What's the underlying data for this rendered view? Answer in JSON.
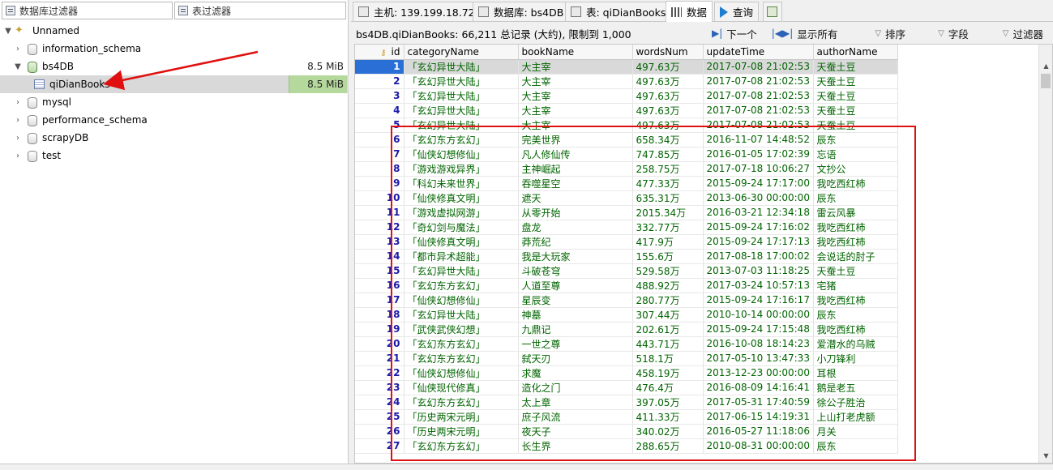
{
  "filters": {
    "db_filter_placeholder": "数据库过滤器",
    "table_filter_placeholder": "表过滤器"
  },
  "tree": {
    "root": "Unnamed",
    "databases": [
      {
        "name": "information_schema",
        "size": ""
      },
      {
        "name": "bs4DB",
        "size": "8.5 MiB"
      },
      {
        "name": "mysql",
        "size": ""
      },
      {
        "name": "performance_schema",
        "size": ""
      },
      {
        "name": "scrapyDB",
        "size": ""
      },
      {
        "name": "test",
        "size": ""
      }
    ],
    "selected_table": {
      "name": "qiDianBooks",
      "size": "8.5 MiB"
    }
  },
  "tabs": [
    {
      "label": "主机: 139.199.18.72"
    },
    {
      "label": "数据库: bs4DB"
    },
    {
      "label": "表: qiDianBooks"
    },
    {
      "label": "数据"
    },
    {
      "label": "查询"
    }
  ],
  "info_bar": {
    "text": "bs4DB.qiDianBooks: 66,211 总记录 (大约), 限制到 1,000",
    "next_label": "下一个",
    "show_all_label": "显示所有",
    "sort_label": "排序",
    "fields_label": "字段",
    "filter_label": "过滤器"
  },
  "table": {
    "columns": [
      "id",
      "categoryName",
      "bookName",
      "wordsNum",
      "updateTime",
      "authorName"
    ],
    "rows": [
      [
        "1",
        "「玄幻异世大陆」",
        "大主宰",
        "497.63万",
        "2017-07-08 21:02:53",
        "天蚕土豆"
      ],
      [
        "2",
        "「玄幻异世大陆」",
        "大主宰",
        "497.63万",
        "2017-07-08 21:02:53",
        "天蚕土豆"
      ],
      [
        "3",
        "「玄幻异世大陆」",
        "大主宰",
        "497.63万",
        "2017-07-08 21:02:53",
        "天蚕土豆"
      ],
      [
        "4",
        "「玄幻异世大陆」",
        "大主宰",
        "497.63万",
        "2017-07-08 21:02:53",
        "天蚕土豆"
      ],
      [
        "5",
        "「玄幻异世大陆」",
        "大主宰",
        "497.63万",
        "2017-07-08 21:02:53",
        "天蚕土豆"
      ],
      [
        "6",
        "「玄幻东方玄幻」",
        "完美世界",
        "658.34万",
        "2016-11-07 14:48:52",
        "辰东"
      ],
      [
        "7",
        "「仙侠幻想修仙」",
        "凡人修仙传",
        "747.85万",
        "2016-01-05 17:02:39",
        "忘语"
      ],
      [
        "8",
        "「游戏游戏异界」",
        "主神崛起",
        "258.75万",
        "2017-07-18 10:06:27",
        "文抄公"
      ],
      [
        "9",
        "「科幻未来世界」",
        "吞噬星空",
        "477.33万",
        "2015-09-24 17:17:00",
        "我吃西红柿"
      ],
      [
        "10",
        "「仙侠修真文明」",
        "遮天",
        "635.31万",
        "2013-06-30 00:00:00",
        "辰东"
      ],
      [
        "11",
        "「游戏虚拟网游」",
        "从零开始",
        "2015.34万",
        "2016-03-21 12:34:18",
        "雷云风暴"
      ],
      [
        "12",
        "「奇幻剑与魔法」",
        "盘龙",
        "332.77万",
        "2015-09-24 17:16:02",
        "我吃西红柿"
      ],
      [
        "13",
        "「仙侠修真文明」",
        "莽荒纪",
        "417.9万",
        "2015-09-24 17:17:13",
        "我吃西红柿"
      ],
      [
        "14",
        "「都市异术超能」",
        "我是大玩家",
        "155.6万",
        "2017-08-18 17:00:02",
        "会说话的肘子"
      ],
      [
        "15",
        "「玄幻异世大陆」",
        "斗破苍穹",
        "529.58万",
        "2013-07-03 11:18:25",
        "天蚕土豆"
      ],
      [
        "16",
        "「玄幻东方玄幻」",
        "人道至尊",
        "488.92万",
        "2017-03-24 10:57:13",
        "宅猪"
      ],
      [
        "17",
        "「仙侠幻想修仙」",
        "星辰变",
        "280.77万",
        "2015-09-24 17:16:17",
        "我吃西红柿"
      ],
      [
        "18",
        "「玄幻异世大陆」",
        "神墓",
        "307.44万",
        "2010-10-14 00:00:00",
        "辰东"
      ],
      [
        "19",
        "「武侠武侠幻想」",
        "九鼎记",
        "202.61万",
        "2015-09-24 17:15:48",
        "我吃西红柿"
      ],
      [
        "20",
        "「玄幻东方玄幻」",
        "一世之尊",
        "443.71万",
        "2016-10-08 18:14:23",
        "爱潜水的乌贼"
      ],
      [
        "21",
        "「玄幻东方玄幻」",
        "弑天刃",
        "518.1万",
        "2017-05-10 13:47:33",
        "小刀锋利"
      ],
      [
        "22",
        "「仙侠幻想修仙」",
        "求魔",
        "458.19万",
        "2013-12-23 00:00:00",
        "耳根"
      ],
      [
        "23",
        "「仙侠现代修真」",
        "造化之门",
        "476.4万",
        "2016-08-09 14:16:41",
        "鹅是老五"
      ],
      [
        "24",
        "「玄幻东方玄幻」",
        "太上章",
        "397.05万",
        "2017-05-31 17:40:59",
        "徐公子胜治"
      ],
      [
        "25",
        "「历史两宋元明」",
        "庶子风流",
        "411.33万",
        "2017-06-15 14:19:31",
        "上山打老虎额"
      ],
      [
        "26",
        "「历史两宋元明」",
        "夜天子",
        "340.02万",
        "2016-05-27 11:18:06",
        "月关"
      ],
      [
        "27",
        "「玄幻东方玄幻」",
        "长生界",
        "288.65万",
        "2010-08-31 00:00:00",
        "辰东"
      ]
    ]
  },
  "colors": {
    "annotation": "#e01010",
    "selected_id_bg": "#2a6fd6",
    "size_highlight": "#b5d99c",
    "cell_text": "#006400"
  }
}
